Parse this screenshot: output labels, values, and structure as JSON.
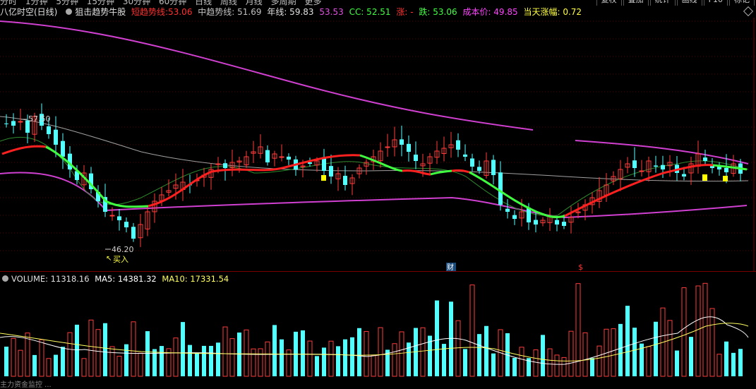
{
  "toolbar": {
    "periods": [
      "分时",
      "1分钟",
      "5分钟",
      "15分钟",
      "30分钟",
      "60分钟",
      "日线",
      "周线",
      "月线",
      "多周期",
      "更多"
    ],
    "right_buttons": [
      "复权",
      "叠加",
      "统计",
      "画线",
      "F10",
      "标记"
    ]
  },
  "main_header": {
    "stock_name": "八亿时空(日线)",
    "indicator_name": "狙击趋势牛股",
    "short_trend_label": "短趋势线:",
    "short_trend_value": "53.06",
    "mid_trend": "中趋势线: 51.69",
    "year_line": "年线: 59.83",
    "extra_value": "53.53",
    "cc": "CC: 52.51",
    "up_label": "涨: -",
    "down": "跌: 53.06",
    "cost_price": "成本价: 49.85",
    "day_change": "当天涨幅: 0.72"
  },
  "annotations": {
    "high_label": "57.50",
    "low_label": "46.20",
    "buy_label": "买入",
    "finance_marker": "财",
    "dollar_marker": "$"
  },
  "volume_header": {
    "volume": "VOLUME: 11318.16",
    "ma5": "MA5: 14381.32",
    "ma10": "MA10: 17331.54"
  },
  "bottom_text": "主力资金监控 ...",
  "colors": {
    "up_candle": "#ff3c3c",
    "down_candle": "#54ffff",
    "short_trend_up": "#ff2020",
    "short_trend_down": "#40ff40",
    "year_line": "#d040d0",
    "ma_line": "#a0a0a0",
    "vol_ma5": "#ffffff",
    "vol_ma10": "#ffff60",
    "yellow_marker": "#ffff00"
  }
}
